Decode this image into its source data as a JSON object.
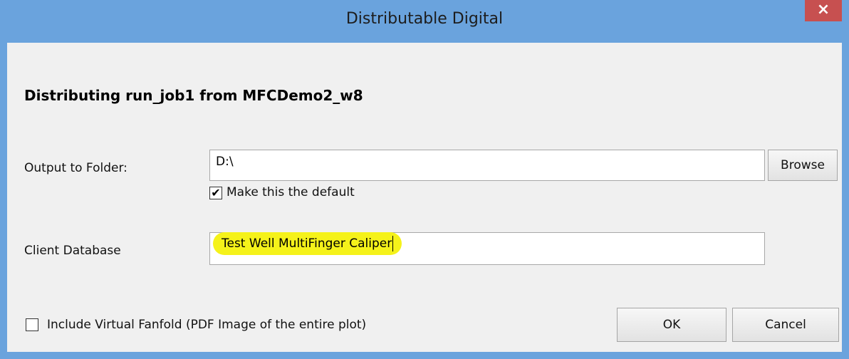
{
  "window": {
    "title": "Distributable Digital",
    "close_glyph": "×"
  },
  "heading": "Distributing run_job1 from MFCDemo2_w8",
  "output": {
    "label": "Output to Folder:",
    "value": "D:\\",
    "browse_label": "Browse",
    "default_checkbox_checked": true,
    "default_checkbox_glyph": "✔",
    "default_label": "Make this the default"
  },
  "client_db": {
    "label": "Client Database",
    "value": "Test Well MultiFinger Caliper",
    "highlight_color": "#f5f21a"
  },
  "fanfold": {
    "checked": false,
    "label": "Include Virtual Fanfold (PDF Image of the entire plot)"
  },
  "buttons": {
    "ok": "OK",
    "cancel": "Cancel"
  },
  "colors": {
    "window_border": "#6aa3dd",
    "close_button": "#c75050",
    "dialog_bg": "#f0f0f0"
  }
}
